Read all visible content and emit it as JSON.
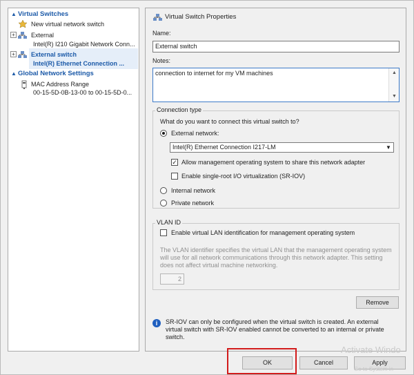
{
  "nav": {
    "virtual_switches_header": "Virtual Switches",
    "new_switch": "New virtual network switch",
    "external": {
      "name": "External",
      "adapter": "Intel(R) I210 Gigabit Network Conn..."
    },
    "external_switch": {
      "name": "External switch",
      "adapter": "Intel(R) Ethernet Connection ..."
    },
    "global_header": "Global Network Settings",
    "mac": {
      "name": "MAC Address Range",
      "range": "00-15-5D-0B-13-00 to 00-15-5D-0..."
    }
  },
  "props": {
    "title": "Virtual Switch Properties",
    "name_label": "Name:",
    "name_value": "External switch",
    "notes_label": "Notes:",
    "notes_value": "connection to internet for my VM machines",
    "connection_type_legend": "Connection type",
    "connection_question": "What do you want to connect this virtual switch to?",
    "external_network_label": "External network:",
    "adapter_selected": "Intel(R) Ethernet Connection I217-LM",
    "allow_mgmt_label": "Allow management operating system to share this network adapter",
    "sriov_label": "Enable single-root I/O virtualization (SR-IOV)",
    "internal_network_label": "Internal network",
    "private_network_label": "Private network",
    "vlan_legend": "VLAN ID",
    "vlan_checkbox_label": "Enable virtual LAN identification for management operating system",
    "vlan_description": "The VLAN identifier specifies the virtual LAN that the management operating system will use for all network communications through this network adapter. This setting does not affect virtual machine networking.",
    "vlan_value": "2",
    "remove_label": "Remove",
    "info_text": "SR-IOV can only be configured when the virtual switch is created. An external virtual switch with SR-IOV enabled cannot be converted to an internal or private switch."
  },
  "footer": {
    "ok": "OK",
    "cancel": "Cancel",
    "apply": "Apply",
    "watermark": "Activate Windo",
    "watermark_small": "Go to System in"
  },
  "state": {
    "external_selected": true,
    "allow_mgmt_checked": true,
    "sriov_checked": false,
    "vlan_checked": false
  }
}
